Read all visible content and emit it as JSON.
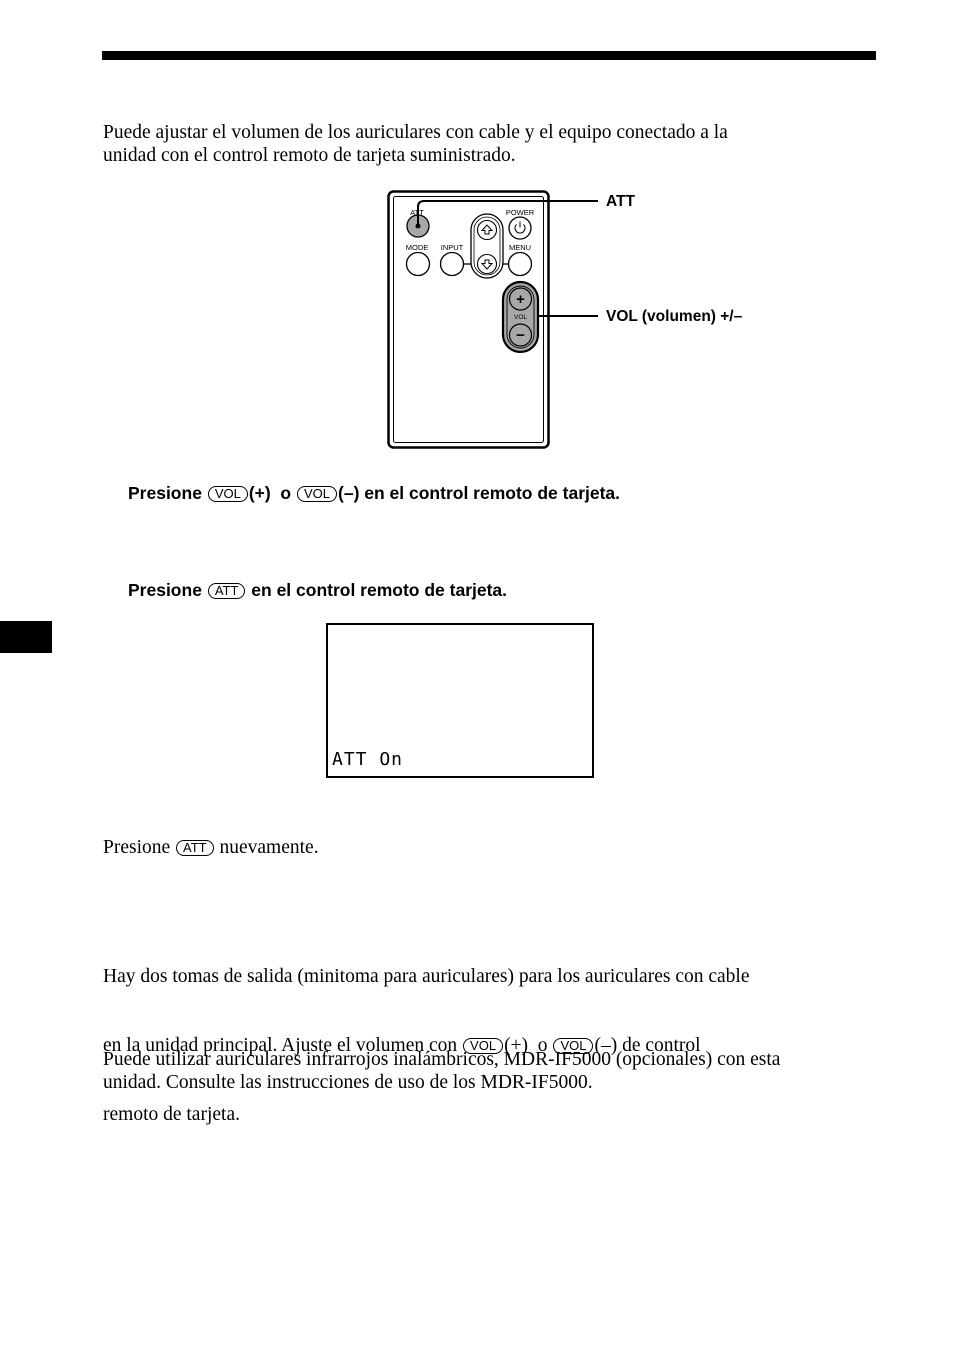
{
  "intro": {
    "line1": "Puede ajustar el volumen de los auriculares con cable y el equipo conectado a la",
    "line2": "unidad con el control remoto de tarjeta suministrado."
  },
  "remote_diagram": {
    "buttons": {
      "att": "ATT",
      "power": "POWER",
      "mode": "MODE",
      "input": "INPUT",
      "menu": "MENU",
      "vol": "VOL",
      "vol_plus": "+",
      "vol_minus": "−"
    },
    "callouts": {
      "att": "ATT",
      "vol": "VOL (volumen) +/–"
    }
  },
  "step_volume": {
    "prefix": "Presione",
    "key1": "VOL",
    "mid": "(+)  o",
    "key2": "VOL",
    "suffix": "(–) en el control remoto de tarjeta."
  },
  "step_att": {
    "prefix": "Presione",
    "key": "ATT",
    "suffix": "en el control remoto de tarjeta."
  },
  "display": {
    "text": "ATT On"
  },
  "cancel_att": {
    "prefix": "Presione",
    "key": "ATT",
    "suffix": "nuevamente."
  },
  "wired_headphones": {
    "line1": "Hay dos tomas de salida (minitoma para auriculares) para los auriculares con cable",
    "line2_prefix": "en la unidad principal. Ajuste el volumen con",
    "key1": "VOL",
    "mid": "(+)  o",
    "key2": "VOL",
    "line2_suffix": "(–) de control",
    "line3": "remoto de tarjeta."
  },
  "wireless_headphones": {
    "line1": "Puede utilizar auriculares infrarrojos inalámbricos, MDR-IF5000 (opcionales) con esta",
    "line2": "unidad. Consulte las instrucciones de uso de los MDR-IF5000."
  }
}
